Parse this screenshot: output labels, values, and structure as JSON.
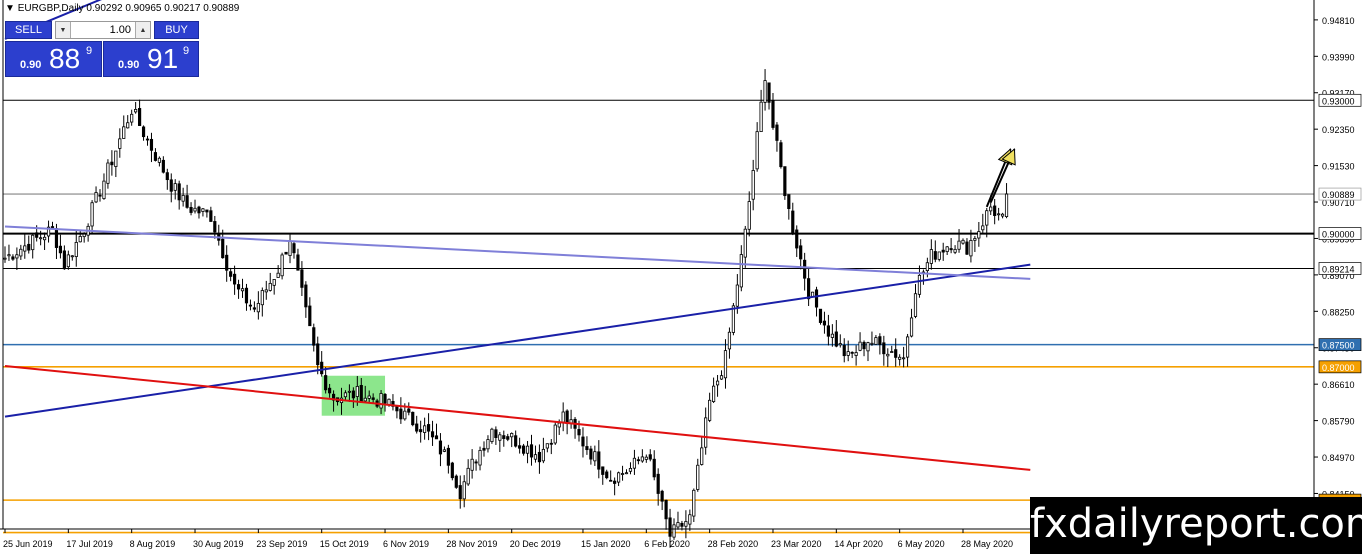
{
  "header": {
    "title": "EURGBP,Daily  0.90292 0.90965 0.90217 0.90889",
    "icon": "triangle-down-icon"
  },
  "trade_panel": {
    "sell_label": "SELL",
    "buy_label": "BUY",
    "lot_value": "1.00",
    "sell_price": {
      "small": "0.90",
      "big": "88",
      "sup": "9"
    },
    "buy_price": {
      "small": "0.90",
      "big": "91",
      "sup": "9"
    }
  },
  "watermark": "fxdailyreport.com",
  "colors": {
    "bull": "#000000",
    "bear": "#000000",
    "trend_blue": "#1a20a8",
    "trend_red": "#e01010",
    "trend_purple": "#7f7fd8",
    "level_orange": "#f5a000",
    "level_blue": "#2f6fb0",
    "zone_green": "#66dd66"
  },
  "chart_data": {
    "type": "candlestick",
    "symbol": "EURGBP",
    "timeframe": "Daily",
    "ylim": [
      0.8335,
      0.9519
    ],
    "yticks": [
      "0.94810",
      "0.93990",
      "0.93170",
      "0.92350",
      "0.91530",
      "0.90710",
      "0.89890",
      "0.89070",
      "0.88250",
      "0.87430",
      "0.86610",
      "0.85790",
      "0.84970",
      "0.84150"
    ],
    "xticks": [
      "25 Jun 2019",
      "17 Jul 2019",
      "8 Aug 2019",
      "30 Aug 2019",
      "23 Sep 2019",
      "15 Oct 2019",
      "6 Nov 2019",
      "28 Nov 2019",
      "20 Dec 2019",
      "15 Jan 2020",
      "6 Feb 2020",
      "28 Feb 2020",
      "23 Mar 2020",
      "14 Apr 2020",
      "6 May 2020",
      "28 May 2020"
    ],
    "horizontal_levels": [
      {
        "label": "0.93000",
        "value": 0.93,
        "color": "#000000"
      },
      {
        "label": "0.90889",
        "value": 0.90889,
        "color": "#aaaaaa"
      },
      {
        "label": "0.90000",
        "value": 0.9,
        "color": "#000000"
      },
      {
        "label": "0.89214",
        "value": 0.89214,
        "color": "#000000"
      },
      {
        "label": "0.87500",
        "value": 0.875,
        "color": "#2f6fb0"
      },
      {
        "label": "0.87000",
        "value": 0.87,
        "color": "#f5a000"
      },
      {
        "label": "0.84000",
        "value": 0.84,
        "color": "#f5a000"
      },
      {
        "label": "",
        "value": 0.8327,
        "color": "#f5a000"
      }
    ],
    "trendlines": [
      {
        "color": "#1a20a8",
        "from": [
          "25 Jun 2019",
          0.8588
        ],
        "to": [
          "22 Jun 2020",
          0.893
        ]
      },
      {
        "color": "#1a20a8",
        "from": [
          "25 Jun 2019",
          0.9438
        ],
        "to": [
          "29 Aug 2019",
          0.9611
        ]
      },
      {
        "color": "#e01010",
        "from": [
          "25 Jun 2019",
          0.8702
        ],
        "to": [
          "22 Jun 2020",
          0.8468
        ]
      },
      {
        "color": "#7f7fd8",
        "from": [
          "25 Jun 2019",
          0.9016
        ],
        "to": [
          "22 Jun 2020",
          0.8898
        ]
      }
    ],
    "zones": [
      {
        "color": "#66dd66",
        "x": [
          "15 Oct 2019",
          "6 Nov 2019"
        ],
        "y": [
          0.859,
          0.868
        ]
      }
    ],
    "arrows": [
      {
        "from": [
          "5 Jun 2020",
          0.906
        ],
        "to": [
          "14 Jun 2020",
          0.919
        ]
      },
      {
        "from": [
          "6 Jun 2020",
          0.907
        ],
        "to": [
          "16 Jun 2020",
          0.919
        ]
      }
    ],
    "anchors": [
      [
        "25 Jun 2019",
        0.8945
      ],
      [
        "11 Jul 2019",
        0.901
      ],
      [
        "16 Jul 2019",
        0.893
      ],
      [
        "23 Jul 2019",
        0.901
      ],
      [
        "30 Jul 2019",
        0.912
      ],
      [
        "8 Aug 2019",
        0.928
      ],
      [
        "14 Aug 2019",
        0.921
      ],
      [
        "22 Aug 2019",
        0.911
      ],
      [
        "28 Aug 2019",
        0.906
      ],
      [
        "5 Sep 2019",
        0.904
      ],
      [
        "13 Sep 2019",
        0.888
      ],
      [
        "20 Sep 2019",
        0.883
      ],
      [
        "30 Sep 2019",
        0.892
      ],
      [
        "3 Oct 2019",
        0.899
      ],
      [
        "9 Oct 2019",
        0.882
      ],
      [
        "14 Oct 2019",
        0.87
      ],
      [
        "18 Oct 2019",
        0.863
      ],
      [
        "28 Oct 2019",
        0.864
      ],
      [
        "6 Nov 2019",
        0.862
      ],
      [
        "13 Nov 2019",
        0.859
      ],
      [
        "20 Nov 2019",
        0.856
      ],
      [
        "28 Nov 2019",
        0.849
      ],
      [
        "3 Dec 2019",
        0.842
      ],
      [
        "6 Dec 2019",
        0.848
      ],
      [
        "13 Dec 2019",
        0.856
      ],
      [
        "20 Dec 2019",
        0.854
      ],
      [
        "31 Dec 2019",
        0.85
      ],
      [
        "8 Jan 2020",
        0.859
      ],
      [
        "15 Jan 2020",
        0.853
      ],
      [
        "24 Jan 2020",
        0.845
      ],
      [
        "31 Jan 2020",
        0.847
      ],
      [
        "6 Feb 2020",
        0.851
      ],
      [
        "14 Feb 2020",
        0.832
      ],
      [
        "21 Feb 2020",
        0.836
      ],
      [
        "28 Feb 2020",
        0.862
      ],
      [
        "5 Mar 2020",
        0.872
      ],
      [
        "12 Mar 2020",
        0.9
      ],
      [
        "19 Mar 2020",
        0.936
      ],
      [
        "23 Mar 2020",
        0.924
      ],
      [
        "27 Mar 2020",
        0.905
      ],
      [
        "3 Apr 2020",
        0.887
      ],
      [
        "10 Apr 2020",
        0.878
      ],
      [
        "17 Apr 2020",
        0.872
      ],
      [
        "24 Apr 2020",
        0.876
      ],
      [
        "1 May 2020",
        0.874
      ],
      [
        "7 May 2020",
        0.872
      ],
      [
        "12 May 2020",
        0.888
      ],
      [
        "18 May 2020",
        0.895
      ],
      [
        "25 May 2020",
        0.898
      ],
      [
        "29 May 2020",
        0.897
      ],
      [
        "3 Jun 2020",
        0.901
      ],
      [
        "8 Jun 2020",
        0.906
      ],
      [
        "11 Jun 2020",
        0.903
      ],
      [
        "12 Jun 2020",
        0.9089
      ]
    ]
  }
}
